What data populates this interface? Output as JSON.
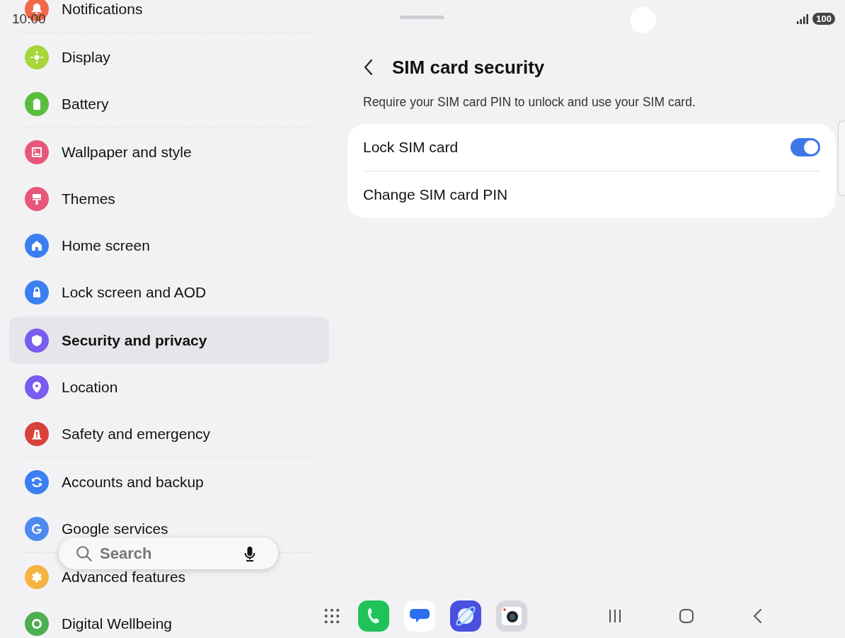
{
  "status_bar": {
    "time": "10:00",
    "battery": "100"
  },
  "sidebar": {
    "groups": [
      {
        "items": [
          {
            "label": "Notifications",
            "color": "#f06a4a",
            "selected": false
          }
        ]
      },
      {
        "items": [
          {
            "label": "Display",
            "color": "#a6d63a",
            "selected": false
          },
          {
            "label": "Battery",
            "color": "#5bbd3d",
            "selected": false
          }
        ]
      },
      {
        "items": [
          {
            "label": "Wallpaper and style",
            "color": "#e8567a",
            "selected": false
          },
          {
            "label": "Themes",
            "color": "#e8567a",
            "selected": false
          },
          {
            "label": "Home screen",
            "color": "#3b7ff0",
            "selected": false
          },
          {
            "label": "Lock screen and AOD",
            "color": "#3b7ff0",
            "selected": false
          }
        ]
      },
      {
        "items": [
          {
            "label": "Security and privacy",
            "color": "#7a5cf0",
            "selected": true
          },
          {
            "label": "Location",
            "color": "#7a5cf0",
            "selected": false
          },
          {
            "label": "Safety and emergency",
            "color": "#d9423a",
            "selected": false
          }
        ]
      },
      {
        "items": [
          {
            "label": "Accounts and backup",
            "color": "#3b7ff0",
            "selected": false
          },
          {
            "label": "Google services",
            "color": "#4d8af0",
            "selected": false
          }
        ]
      },
      {
        "items": [
          {
            "label": "Advanced features",
            "color": "#f5b342",
            "selected": false
          },
          {
            "label": "Digital Wellbeing",
            "color": "#4caf50",
            "selected": false
          }
        ]
      }
    ]
  },
  "search": {
    "placeholder": "Search"
  },
  "panel": {
    "title": "SIM card security",
    "description": "Require your SIM card PIN to unlock and use your SIM card.",
    "settings": [
      {
        "kind": "toggle",
        "label": "Lock SIM card",
        "on": true
      },
      {
        "kind": "link",
        "label": "Change SIM card PIN"
      }
    ]
  }
}
